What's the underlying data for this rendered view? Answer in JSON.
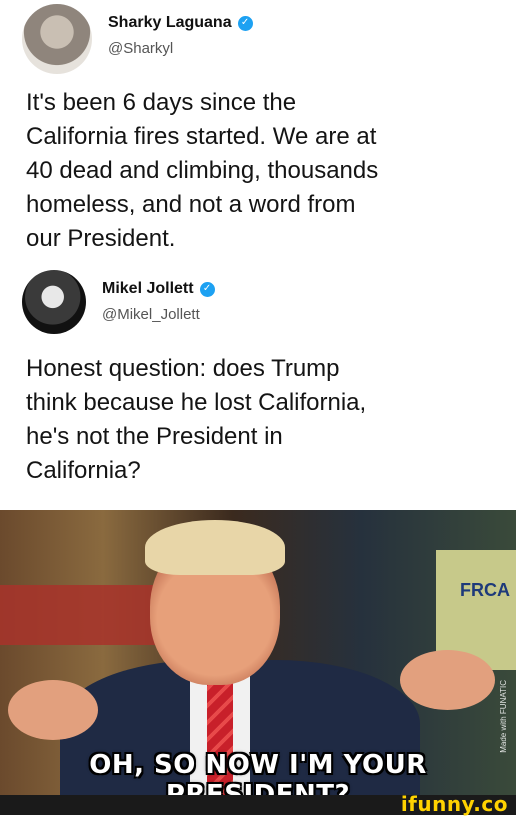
{
  "tweet1": {
    "display_name": "Sharky Laguana",
    "handle": "@Sharkyl",
    "text": "It's been 6 days since the\nCalifornia fires started. We are at\n40 dead and climbing, thousands\nhomeless, and not a word from\nour President."
  },
  "tweet2": {
    "display_name": "Mikel Jollett",
    "handle": "@Mikel_Jollett",
    "text": "Honest question: does Trump\nthink because he lost California,\nhe's not the President in\nCalifornia?"
  },
  "meme": {
    "caption": "OH, SO NOW I'M YOUR PRESIDENT?",
    "background_sign": "FRCA",
    "side_watermark": "Made with FUNATIC"
  },
  "footer": {
    "brand": "ifunny.co"
  },
  "icons": {
    "verified": "verified-badge-icon"
  },
  "colors": {
    "verified_blue": "#1da1f2",
    "ifunny_yellow": "#ffd200"
  }
}
